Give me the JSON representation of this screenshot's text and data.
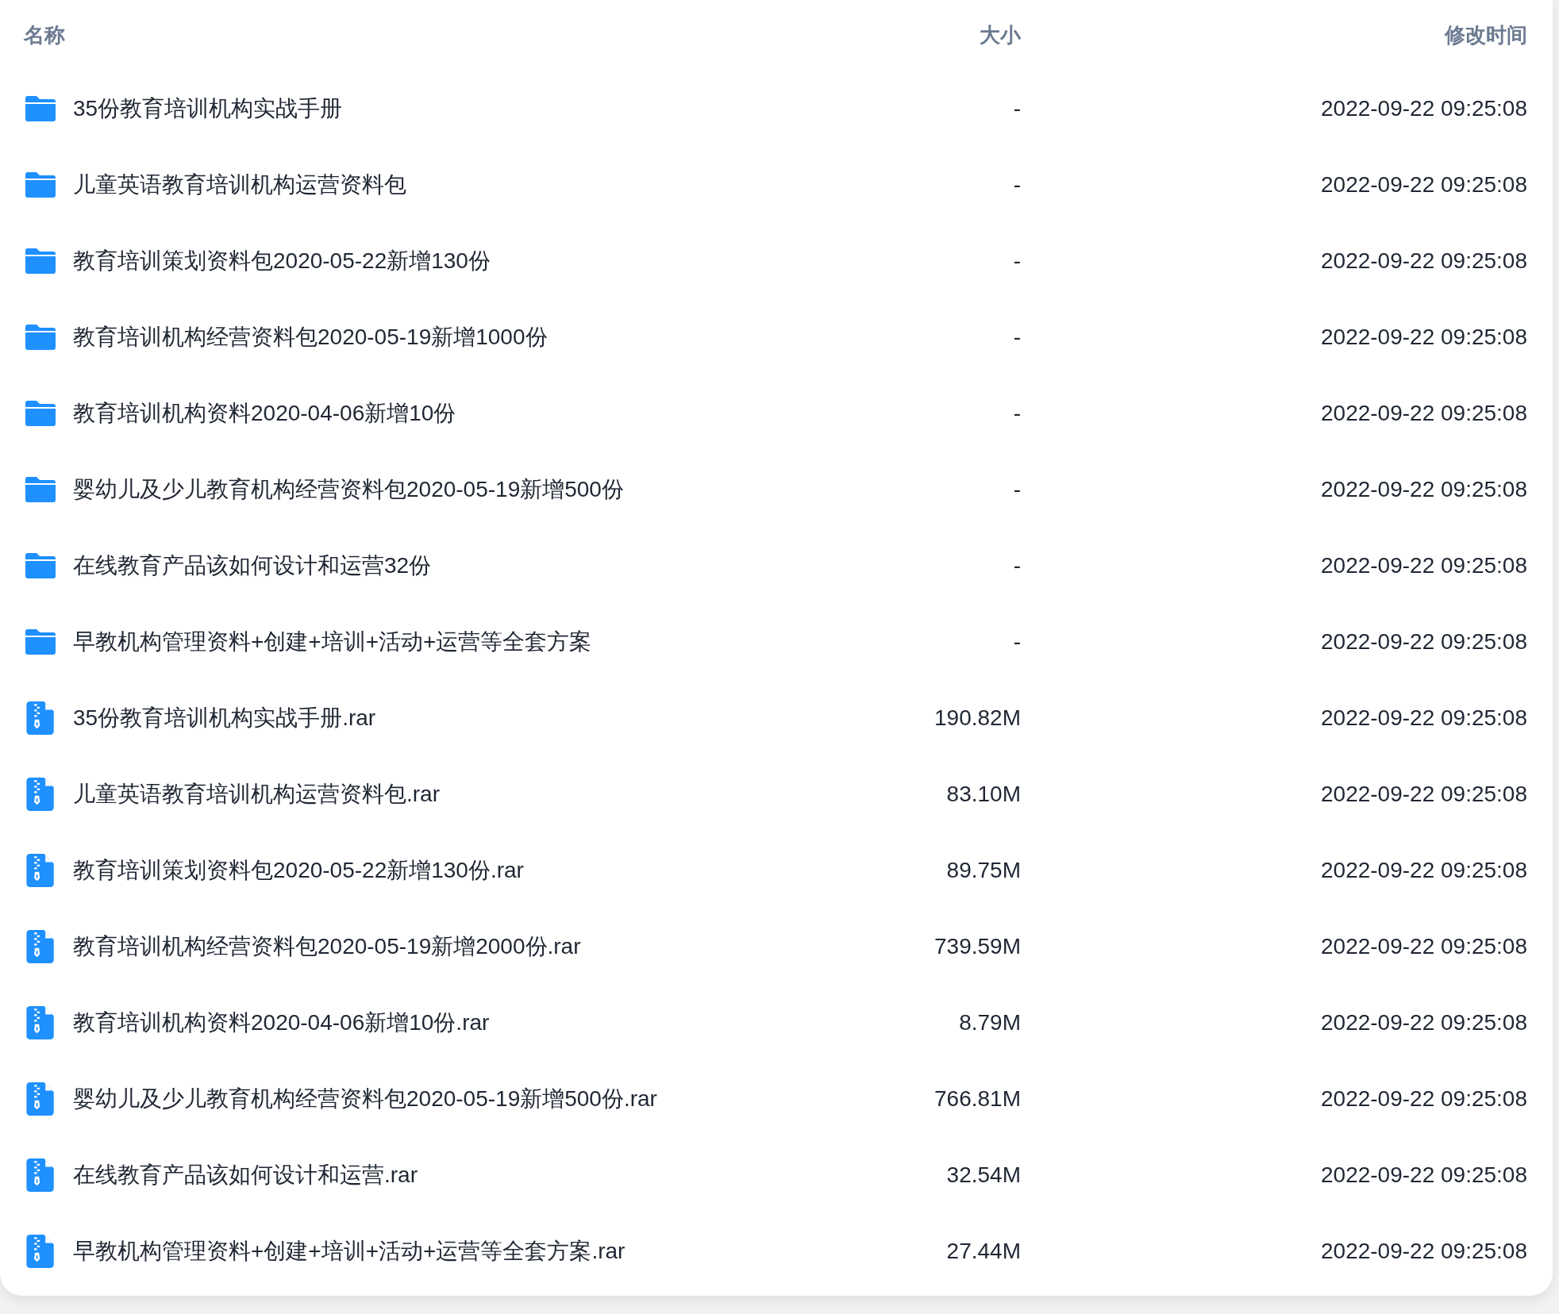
{
  "table": {
    "columns": [
      "名称",
      "大小",
      "修改时间"
    ],
    "rows": [
      {
        "kind": "folder",
        "name": "35份教育培训机构实战手册",
        "size": "-",
        "modified": "2022-09-22 09:25:08"
      },
      {
        "kind": "folder",
        "name": "儿童英语教育培训机构运营资料包",
        "size": "-",
        "modified": "2022-09-22 09:25:08"
      },
      {
        "kind": "folder",
        "name": "教育培训策划资料包2020-05-22新增130份",
        "size": "-",
        "modified": "2022-09-22 09:25:08"
      },
      {
        "kind": "folder",
        "name": "教育培训机构经营资料包2020-05-19新增1000份",
        "size": "-",
        "modified": "2022-09-22 09:25:08"
      },
      {
        "kind": "folder",
        "name": "教育培训机构资料2020-04-06新增10份",
        "size": "-",
        "modified": "2022-09-22 09:25:08"
      },
      {
        "kind": "folder",
        "name": "婴幼儿及少儿教育机构经营资料包2020-05-19新增500份",
        "size": "-",
        "modified": "2022-09-22 09:25:08"
      },
      {
        "kind": "folder",
        "name": "在线教育产品该如何设计和运营32份",
        "size": "-",
        "modified": "2022-09-22 09:25:08"
      },
      {
        "kind": "folder",
        "name": "早教机构管理资料+创建+培训+活动+运营等全套方案",
        "size": "-",
        "modified": "2022-09-22 09:25:08"
      },
      {
        "kind": "archive",
        "name": "35份教育培训机构实战手册.rar",
        "size": "190.82M",
        "modified": "2022-09-22 09:25:08"
      },
      {
        "kind": "archive",
        "name": "儿童英语教育培训机构运营资料包.rar",
        "size": "83.10M",
        "modified": "2022-09-22 09:25:08"
      },
      {
        "kind": "archive",
        "name": "教育培训策划资料包2020-05-22新增130份.rar",
        "size": "89.75M",
        "modified": "2022-09-22 09:25:08"
      },
      {
        "kind": "archive",
        "name": "教育培训机构经营资料包2020-05-19新增2000份.rar",
        "size": "739.59M",
        "modified": "2022-09-22 09:25:08"
      },
      {
        "kind": "archive",
        "name": "教育培训机构资料2020-04-06新增10份.rar",
        "size": "8.79M",
        "modified": "2022-09-22 09:25:08"
      },
      {
        "kind": "archive",
        "name": "婴幼儿及少儿教育机构经营资料包2020-05-19新增500份.rar",
        "size": "766.81M",
        "modified": "2022-09-22 09:25:08"
      },
      {
        "kind": "archive",
        "name": "在线教育产品该如何设计和运营.rar",
        "size": "32.54M",
        "modified": "2022-09-22 09:25:08"
      },
      {
        "kind": "archive",
        "name": "早教机构管理资料+创建+培训+活动+运营等全套方案.rar",
        "size": "27.44M",
        "modified": "2022-09-22 09:25:08"
      }
    ]
  }
}
